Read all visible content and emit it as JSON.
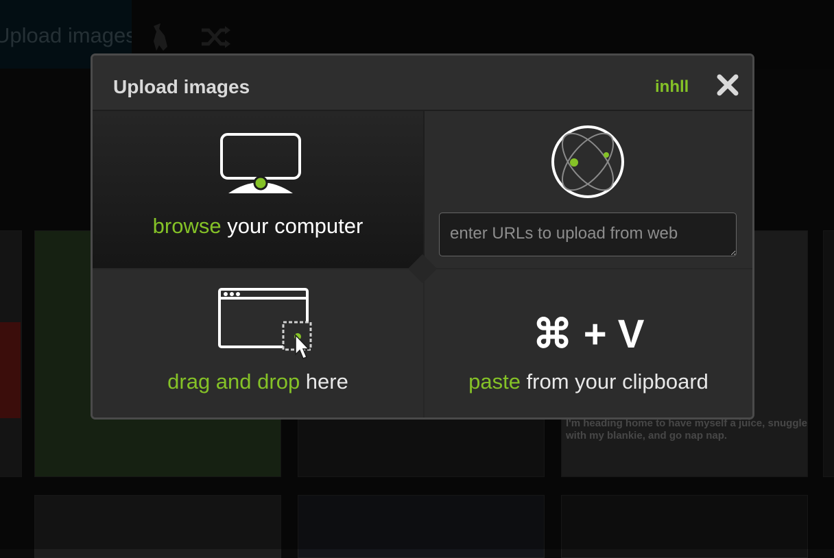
{
  "background": {
    "upload_tab_label": "Upload images",
    "caption_text": "I'm heading home to have myself a juice, snuggle with my blankie, and go nap nap."
  },
  "dialog": {
    "title": "Upload images",
    "username": "inhll",
    "close_icon": "close-icon",
    "browse": {
      "highlight": "browse",
      "rest": " your computer",
      "icon": "monitor-icon"
    },
    "web": {
      "placeholder": "enter URLs to upload from web",
      "icon": "globe-icon"
    },
    "drag": {
      "highlight": "drag and drop",
      "rest": " here",
      "icon": "browser-window-drop-icon"
    },
    "paste": {
      "shortcut": "⌘ + V",
      "highlight": "paste",
      "rest": " from your clipboard"
    }
  },
  "colors": {
    "accent": "#85c227",
    "dialog_bg": "#303030",
    "text": "#ffffff"
  }
}
